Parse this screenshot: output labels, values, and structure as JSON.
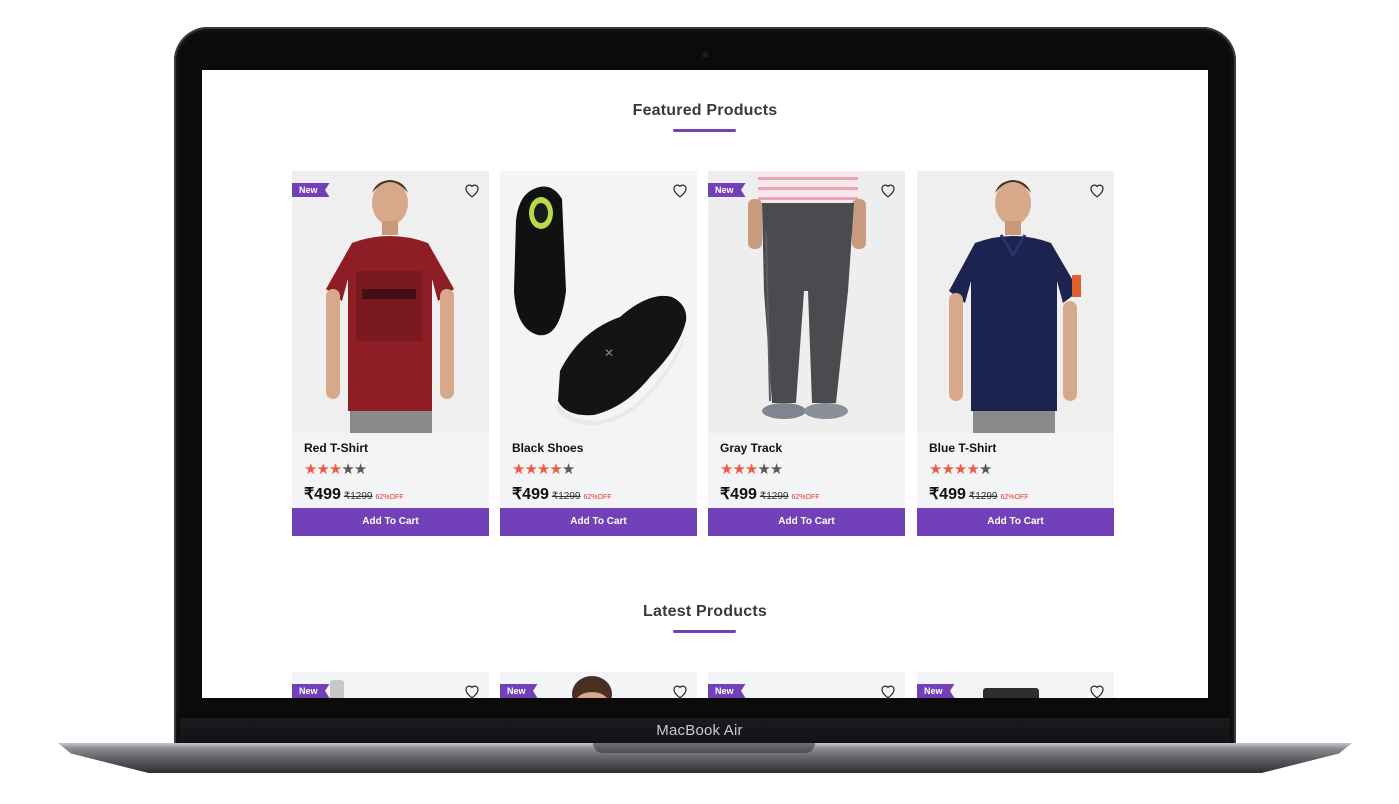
{
  "device": {
    "label": "MacBook Air"
  },
  "featured": {
    "title": "Featured Products",
    "products": [
      {
        "badge": "New",
        "name": "Red T-Shirt",
        "rating": 3,
        "price": "₹499",
        "old_price": "₹1299",
        "discount": "62%OFF",
        "cta": "Add To Cart",
        "image": "red-tshirt-photo",
        "wishlist_icon": "heart-outline-icon"
      },
      {
        "badge": "",
        "name": "Black Shoes",
        "rating": 4,
        "price": "₹499",
        "old_price": "₹1299",
        "discount": "62%OFF",
        "cta": "Add To Cart",
        "image": "black-shoes-photo",
        "wishlist_icon": "heart-outline-icon"
      },
      {
        "badge": "New",
        "name": "Gray Track",
        "rating": 3,
        "price": "₹499",
        "old_price": "₹1299",
        "discount": "62%OFF",
        "cta": "Add To Cart",
        "image": "gray-track-photo",
        "wishlist_icon": "heart-outline-icon"
      },
      {
        "badge": "",
        "name": "Blue T-Shirt",
        "rating": 4,
        "price": "₹499",
        "old_price": "₹1299",
        "discount": "62%OFF",
        "cta": "Add To Cart",
        "image": "blue-tshirt-photo",
        "wishlist_icon": "heart-outline-icon"
      }
    ]
  },
  "latest": {
    "title": "Latest Products",
    "products": [
      {
        "badge": "New"
      },
      {
        "badge": "New"
      },
      {
        "badge": "New"
      },
      {
        "badge": "New"
      }
    ]
  },
  "colors": {
    "accent": "#7240b8",
    "star_on": "#f05a48",
    "discount": "#e03a2e"
  }
}
